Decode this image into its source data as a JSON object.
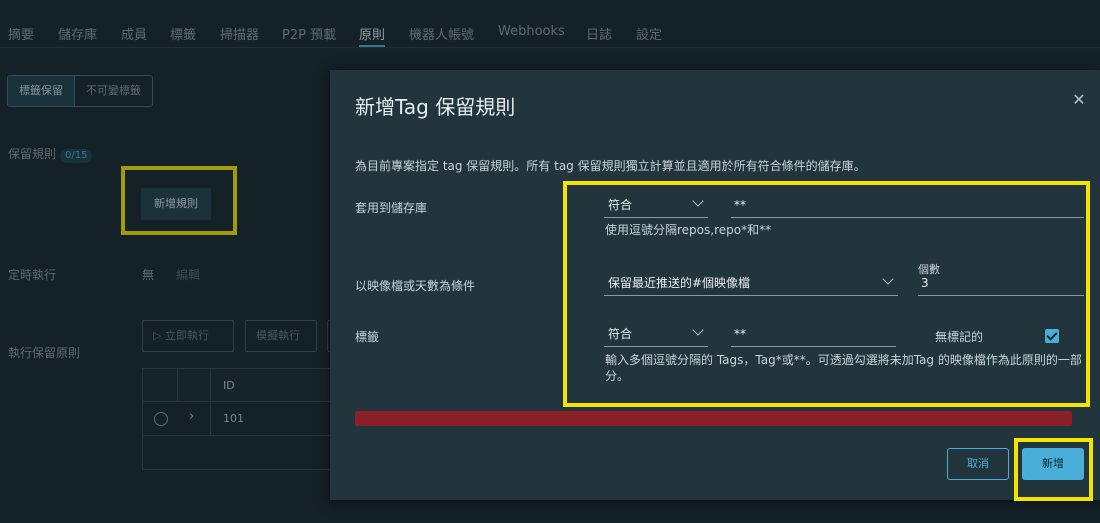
{
  "nav": {
    "tabs": [
      {
        "label": "摘要"
      },
      {
        "label": "儲存庫"
      },
      {
        "label": "成員"
      },
      {
        "label": "標籤"
      },
      {
        "label": "掃描器"
      },
      {
        "label": "P2P 預載"
      },
      {
        "label": "原則"
      },
      {
        "label": "機器人帳號"
      },
      {
        "label": "Webhooks"
      },
      {
        "label": "日誌"
      },
      {
        "label": "設定"
      }
    ],
    "active": "原則"
  },
  "page": {
    "segments": [
      "標籤保留",
      "不可變標籤"
    ],
    "retention_label": "保留規則",
    "retention_count": "0/15",
    "add_rule": "新增規則",
    "schedule_label": "定時執行",
    "schedule_value": "無",
    "schedule_edit": "編輯",
    "run_label": "執行保留原則",
    "run_now": "▷ 立即執行",
    "dry_run": "模擬執行",
    "table": {
      "header_id": "ID",
      "row_id": "101"
    }
  },
  "modal": {
    "title": "新增Tag 保留規則",
    "description": "為目前專案指定 tag 保留規則。所有 tag 保留規則獨立計算並且適用於所有符合條件的儲存庫。",
    "repo": {
      "label": "套用到儲存庫",
      "select": "符合",
      "value": "**",
      "help": "使用逗號分隔repos,repo*和**"
    },
    "condition": {
      "label": "以映像檔或天數為條件",
      "select": "保留最近推送的#個映像檔",
      "count_label": "個數",
      "count_value": "3"
    },
    "tags": {
      "label": "標籤",
      "select": "符合",
      "value": "**",
      "untagged_label": "無標記的",
      "untagged_checked": true,
      "help": "輸入多個逗號分隔的 Tags，Tag*或**。可透過勾選將未加Tag 的映像檔作為此原則的一部分。"
    },
    "cancel": "取消",
    "submit": "新增"
  },
  "colors": {
    "accent": "#49afd9",
    "highlight": "#f5e400",
    "error": "#8b2028"
  }
}
